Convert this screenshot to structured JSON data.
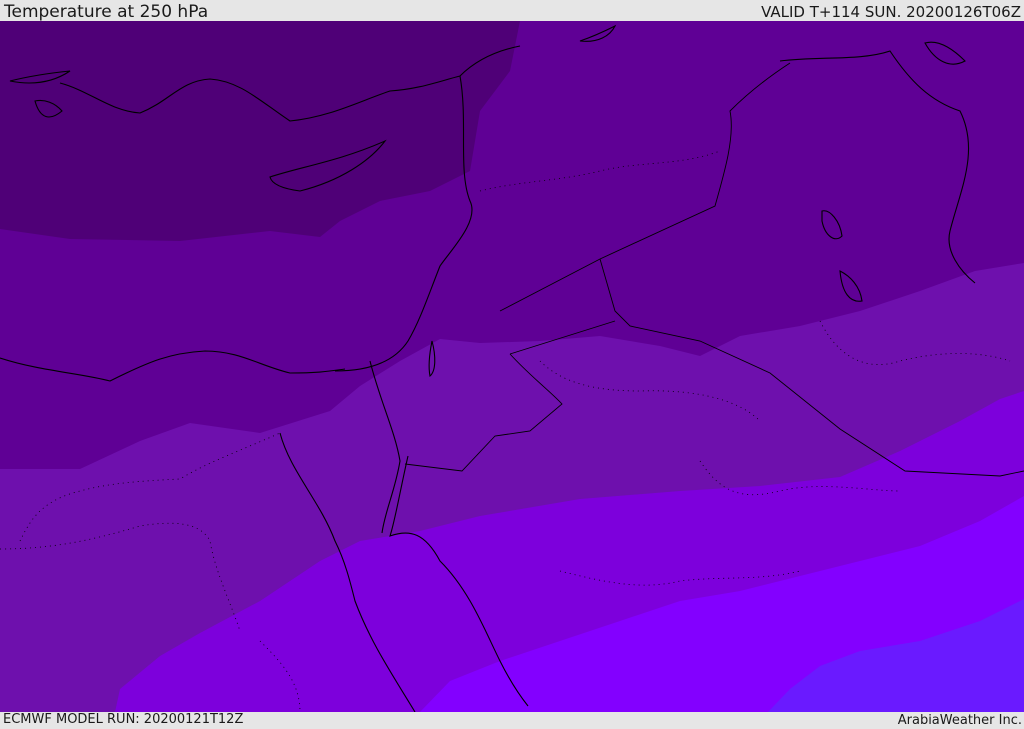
{
  "header": {
    "title": "Temperature at 250 hPa",
    "valid_time": "VALID T+114 SUN. 20200126T06Z"
  },
  "footer": {
    "model_run": "ECMWF MODEL RUN: 20200121T12Z",
    "credit": "ArabiaWeather Inc."
  },
  "map": {
    "type": "filled-contour",
    "field": "temperature",
    "level": "250 hPa",
    "band_colors": [
      "#4f0077",
      "#5f0095",
      "#6e10ad",
      "#7d00dc",
      "#8300ff",
      "#6a1aff"
    ],
    "land_outline_color": "#000000",
    "borders": "dotted"
  }
}
